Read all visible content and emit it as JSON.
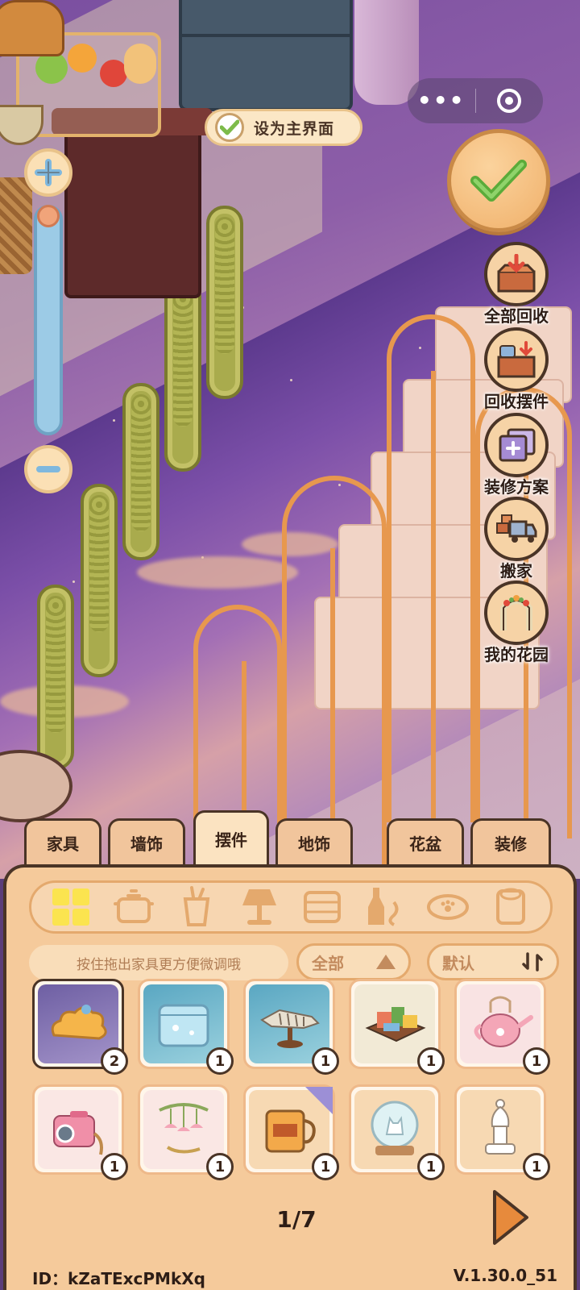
{
  "hud": {
    "set_main_label": "设为主界面",
    "menu_dots": "•••"
  },
  "side_buttons": [
    {
      "key": "recycle_all",
      "label": "全部回收",
      "icon": "box-down-arrow-icon"
    },
    {
      "key": "recycle_decor",
      "label": "回收摆件",
      "icon": "box-recycle-icon"
    },
    {
      "key": "renovation_plan",
      "label": "装修方案",
      "icon": "cards-plus-icon"
    },
    {
      "key": "move_house",
      "label": "搬家",
      "icon": "truck-icon"
    },
    {
      "key": "my_garden",
      "label": "我的花园",
      "icon": "garden-arch-icon"
    }
  ],
  "tabs": [
    {
      "label": "家具",
      "active": false
    },
    {
      "label": "墙饰",
      "active": false
    },
    {
      "label": "摆件",
      "active": true
    },
    {
      "label": "地饰",
      "active": false
    },
    {
      "label": "花盆",
      "active": false
    },
    {
      "label": "装修",
      "active": false
    }
  ],
  "categories": [
    "grid-all-icon",
    "pot-icon",
    "cup-icon",
    "lamp-icon",
    "pillow-icon",
    "bottle-icon",
    "pet-bowl-icon",
    "roll-icon"
  ],
  "toolbar": {
    "hint": "按住拖出家具更方便微调哦",
    "filter_label": "全部",
    "sort_label": "默认"
  },
  "items": [
    {
      "name": "cloud-pillow",
      "count": "2",
      "bg": "#7c6aa8"
    },
    {
      "name": "glass-aquarium",
      "count": "1",
      "bg": "#6fb4c8"
    },
    {
      "name": "fish-skeleton-stand",
      "count": "1",
      "bg": "#6fb4c8"
    },
    {
      "name": "craft-box",
      "count": "1",
      "bg": "#f2ead6"
    },
    {
      "name": "pink-teapot",
      "count": "1",
      "bg": "#f9e3e3"
    },
    {
      "name": "pink-camera",
      "count": "1",
      "bg": "#fae7e4"
    },
    {
      "name": "wind-chime",
      "count": "1",
      "bg": "#fae7e4"
    },
    {
      "name": "orange-mug",
      "count": "1",
      "bg": "#f7d9b3"
    },
    {
      "name": "cat-snow-globe",
      "count": "1",
      "bg": "#f7d9b3"
    },
    {
      "name": "chess-bishop",
      "count": "1",
      "bg": "#f7d9b3"
    }
  ],
  "pager": {
    "text": "1/7"
  },
  "footer": {
    "id": "ID：kZaTExcPMkXq",
    "version": "V.1.30.0_51"
  },
  "colors": {
    "panel": "#f5ca9b",
    "outline": "#4a3426",
    "accent": "#e78a3c"
  }
}
